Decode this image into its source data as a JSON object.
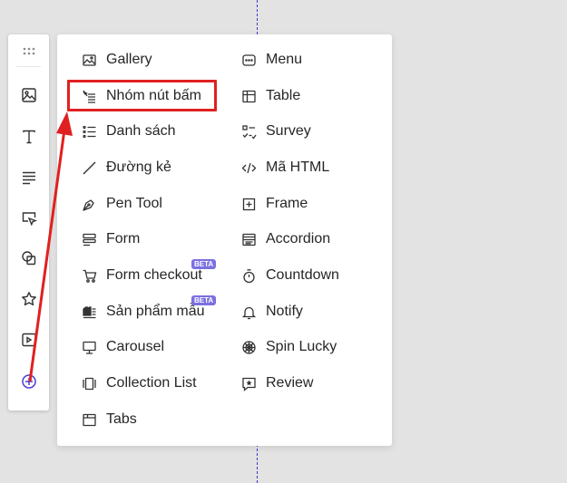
{
  "canvas": {
    "guide_color": "#3a3ad0"
  },
  "toolbar": {
    "items": [
      {
        "name": "drag-handle-icon"
      },
      {
        "name": "image-icon"
      },
      {
        "name": "text-icon"
      },
      {
        "name": "paragraph-icon"
      },
      {
        "name": "button-cursor-icon"
      },
      {
        "name": "shapes-icon"
      },
      {
        "name": "star-icon"
      },
      {
        "name": "video-icon"
      },
      {
        "name": "add-element-icon",
        "active": true
      }
    ],
    "active_color": "#4b3fd6"
  },
  "menu": {
    "left": [
      {
        "label": "Gallery",
        "icon": "gallery-icon"
      },
      {
        "label": "Nhóm nút bấm",
        "icon": "button-group-icon",
        "highlighted": true
      },
      {
        "label": "Danh sách",
        "icon": "list-icon"
      },
      {
        "label": "Đường kẻ",
        "icon": "line-icon"
      },
      {
        "label": "Pen Tool",
        "icon": "pen-tool-icon"
      },
      {
        "label": "Form",
        "icon": "form-icon"
      },
      {
        "label": "Form checkout",
        "icon": "cart-icon",
        "badge": "BETA"
      },
      {
        "label": "Sản phẩm mẫu",
        "icon": "product-sample-icon",
        "badge": "BETA"
      },
      {
        "label": "Carousel",
        "icon": "carousel-icon"
      },
      {
        "label": "Collection List",
        "icon": "collection-list-icon"
      },
      {
        "label": "Tabs",
        "icon": "tabs-icon"
      }
    ],
    "right": [
      {
        "label": "Menu",
        "icon": "menu-icon"
      },
      {
        "label": "Table",
        "icon": "table-icon"
      },
      {
        "label": "Survey",
        "icon": "survey-icon"
      },
      {
        "label": "Mã HTML",
        "icon": "code-icon"
      },
      {
        "label": "Frame",
        "icon": "frame-icon"
      },
      {
        "label": "Accordion",
        "icon": "accordion-icon"
      },
      {
        "label": "Countdown",
        "icon": "timer-icon"
      },
      {
        "label": "Notify",
        "icon": "bell-icon"
      },
      {
        "label": "Spin Lucky",
        "icon": "spin-wheel-icon"
      },
      {
        "label": "Review",
        "icon": "review-icon"
      }
    ]
  },
  "annotation": {
    "color": "#e02020"
  }
}
